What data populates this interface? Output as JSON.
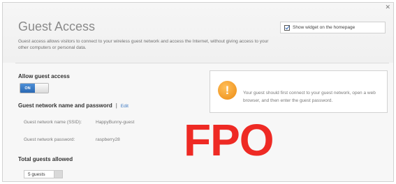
{
  "panel": {
    "close_glyph": "✕",
    "title": "Guest Access",
    "description": "Guest access allows visitors to connect to your wireless guest network and access the Internet, without giving access to your other computers or personal data.",
    "widget_checkbox": {
      "label": "Show widget on the homepage",
      "checked": true
    }
  },
  "allow_guest": {
    "label": "Allow guest access",
    "toggle_label": "ON",
    "enabled": true
  },
  "network": {
    "heading": "Guest network name and password",
    "separator": "|",
    "edit_label": "Edit",
    "ssid_label": "Guest network name (SSID):",
    "ssid_value": "HappyBunny-guest",
    "password_label": "Guest network password:",
    "password_value": "raspberry28"
  },
  "total_guests": {
    "label": "Total guests allowed",
    "selected": "5 guests"
  },
  "notice": {
    "icon": "warning-icon",
    "icon_glyph": "!",
    "text": "Your guest should first connect to your guest network, open a web browser, and then enter the guest password."
  },
  "overlay": {
    "text": "FPO"
  },
  "colors": {
    "accent": "#2a68b3",
    "warning": "#ec8b13",
    "overlay": "#ee2a24",
    "link": "#3b78c2"
  }
}
